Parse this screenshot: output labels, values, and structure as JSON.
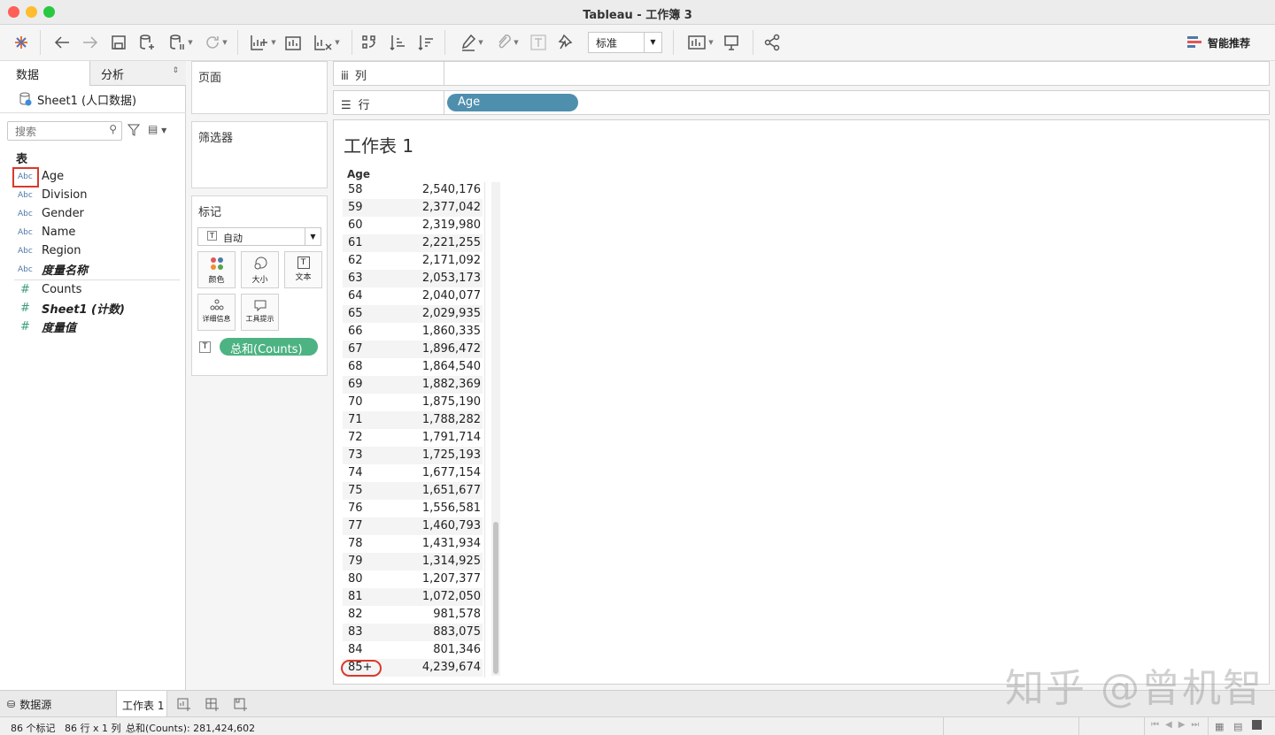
{
  "window": {
    "title": "Tableau - 工作簿 3"
  },
  "toolbar": {
    "show_me_label": "智能推荐",
    "fit_select": "标准"
  },
  "left_panel": {
    "tab_data": "数据",
    "tab_analysis": "分析",
    "datasource": "Sheet1 (人口数据)",
    "search_placeholder": "搜索",
    "section_label": "表",
    "dimensions": [
      {
        "type": "Abc",
        "name": "Age"
      },
      {
        "type": "Abc",
        "name": "Division"
      },
      {
        "type": "Abc",
        "name": "Gender"
      },
      {
        "type": "Abc",
        "name": "Name"
      },
      {
        "type": "Abc",
        "name": "Region"
      },
      {
        "type": "Abc",
        "name": "度量名称"
      }
    ],
    "measures": [
      {
        "type": "#",
        "name": "Counts"
      },
      {
        "type": "#",
        "name": "Sheet1 (计数)"
      },
      {
        "type": "#",
        "name": "度量值"
      }
    ]
  },
  "cards": {
    "pages": "页面",
    "filters": "筛选器",
    "marks": "标记",
    "mark_type": "自动",
    "color": "颜色",
    "size": "大小",
    "text": "文本",
    "detail": "详细信息",
    "tooltip": "工具提示",
    "measure_pill": "总和(Counts)"
  },
  "shelves": {
    "columns_label": "列",
    "rows_label": "行",
    "rows_pill": "Age"
  },
  "sheet": {
    "title": "工作表 1",
    "column_header": "Age"
  },
  "table": {
    "rows": [
      {
        "age": "58",
        "value": "2,540,176"
      },
      {
        "age": "59",
        "value": "2,377,042"
      },
      {
        "age": "60",
        "value": "2,319,980"
      },
      {
        "age": "61",
        "value": "2,221,255"
      },
      {
        "age": "62",
        "value": "2,171,092"
      },
      {
        "age": "63",
        "value": "2,053,173"
      },
      {
        "age": "64",
        "value": "2,040,077"
      },
      {
        "age": "65",
        "value": "2,029,935"
      },
      {
        "age": "66",
        "value": "1,860,335"
      },
      {
        "age": "67",
        "value": "1,896,472"
      },
      {
        "age": "68",
        "value": "1,864,540"
      },
      {
        "age": "69",
        "value": "1,882,369"
      },
      {
        "age": "70",
        "value": "1,875,190"
      },
      {
        "age": "71",
        "value": "1,788,282"
      },
      {
        "age": "72",
        "value": "1,791,714"
      },
      {
        "age": "73",
        "value": "1,725,193"
      },
      {
        "age": "74",
        "value": "1,677,154"
      },
      {
        "age": "75",
        "value": "1,651,677"
      },
      {
        "age": "76",
        "value": "1,556,581"
      },
      {
        "age": "77",
        "value": "1,460,793"
      },
      {
        "age": "78",
        "value": "1,431,934"
      },
      {
        "age": "79",
        "value": "1,314,925"
      },
      {
        "age": "80",
        "value": "1,207,377"
      },
      {
        "age": "81",
        "value": "1,072,050"
      },
      {
        "age": "82",
        "value": "981,578"
      },
      {
        "age": "83",
        "value": "883,075"
      },
      {
        "age": "84",
        "value": "801,346"
      },
      {
        "age": "85+",
        "value": "4,239,674"
      }
    ]
  },
  "bottom_tabs": {
    "datasource": "数据源",
    "sheet": "工作表 1"
  },
  "status": {
    "marks": "86 个标记",
    "rowscols": "86 行 x 1 列",
    "sum": "总和(Counts): 281,424,602"
  },
  "watermark": "知乎 @曾机智",
  "colors": {
    "accent_blue": "#4e8fae",
    "measure_green": "#4db383",
    "highlight_red": "#d9392c"
  }
}
